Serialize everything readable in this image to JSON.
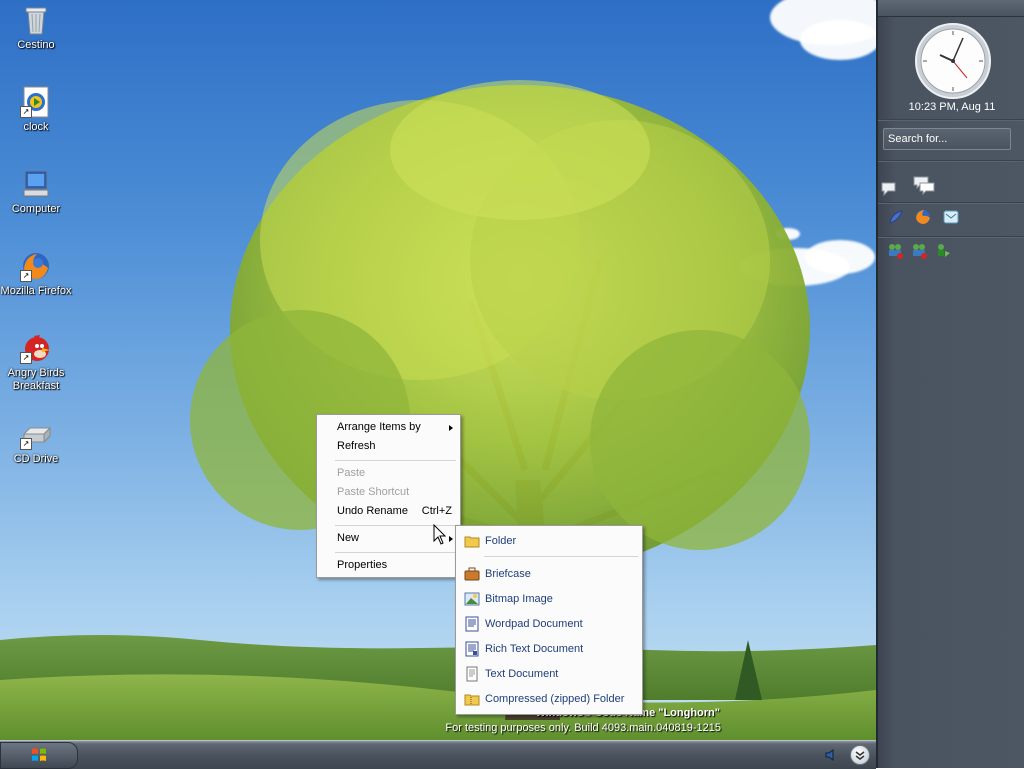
{
  "desktop_icons": [
    {
      "label": "Cestino",
      "icon": "recycle-bin-icon"
    },
    {
      "label": "clock",
      "icon": "media-file-icon"
    },
    {
      "label": "Computer",
      "icon": "computer-icon"
    },
    {
      "label": "Mozilla Firefox",
      "icon": "firefox-icon"
    },
    {
      "label": "Angry Birds Breakfast",
      "icon": "angry-bird-icon"
    },
    {
      "label": "CD Drive",
      "icon": "cd-drive-icon"
    }
  ],
  "context_menu": {
    "items": [
      {
        "label": "Arrange Items by",
        "has_submenu": true,
        "enabled": true
      },
      {
        "label": "Refresh",
        "enabled": true
      },
      {
        "label": "Paste",
        "enabled": false
      },
      {
        "label": "Paste Shortcut",
        "enabled": false
      },
      {
        "label": "Undo Rename",
        "shortcut": "Ctrl+Z",
        "enabled": true
      },
      {
        "label": "New",
        "has_submenu": true,
        "enabled": true
      },
      {
        "label": "Properties",
        "enabled": true
      }
    ]
  },
  "new_submenu": {
    "items": [
      {
        "label": "Folder",
        "icon": "folder-icon"
      },
      {
        "label": "Briefcase",
        "icon": "briefcase-icon"
      },
      {
        "label": "Bitmap Image",
        "icon": "bitmap-image-icon"
      },
      {
        "label": "Wordpad Document",
        "icon": "wordpad-document-icon"
      },
      {
        "label": "Rich Text Document",
        "icon": "rich-text-document-icon"
      },
      {
        "label": "Text Document",
        "icon": "text-document-icon"
      },
      {
        "label": "Compressed (zipped) Folder",
        "icon": "zipped-folder-icon"
      }
    ]
  },
  "sidebar": {
    "clock_time": "10:23 PM, Aug 11",
    "search_placeholder": "Search for..."
  },
  "watermark": {
    "line1": "Windows® Code Name \"Longhorn\"",
    "line2": "For testing purposes only. Build 4093.main.040819-1215"
  },
  "colors": {
    "sidebar_bg": "#4d5763",
    "submenu_text": "#1f3f7a",
    "disabled_text": "#a0a0a0"
  }
}
